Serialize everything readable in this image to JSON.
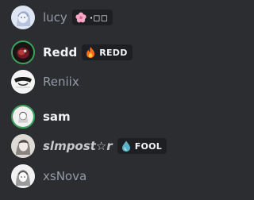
{
  "members": [
    {
      "name": "lucy",
      "tag": "·◻◻",
      "tag_icon": "cherry-blossom-icon"
    },
    {
      "name": "Redd",
      "tag": "REDD",
      "tag_icon": "fire-icon"
    },
    {
      "name": "Reniix"
    },
    {
      "name": "sam"
    },
    {
      "name": "slmpost☆r",
      "tag": "FOOL",
      "tag_icon": "water-drop-icon"
    },
    {
      "name": "xsNova"
    }
  ],
  "colors": {
    "background": "#2b2d31",
    "name_muted": "#949ba4",
    "name_bold": "#f2f3f5",
    "online_ring": "#3ba55d",
    "tag_background": "#1e1f22"
  }
}
